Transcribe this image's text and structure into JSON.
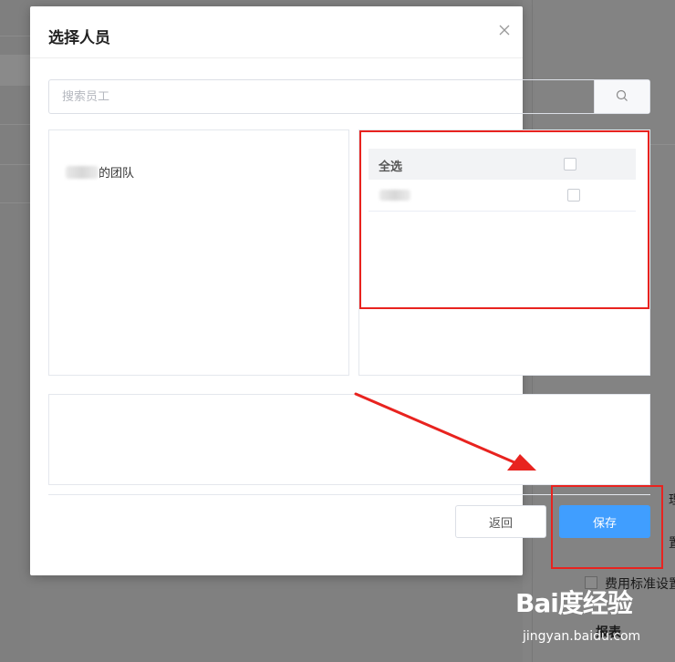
{
  "dialog": {
    "title": "选择人员",
    "close_icon": "close-icon"
  },
  "search": {
    "placeholder": "搜索员工",
    "value": "",
    "icon": "search-icon"
  },
  "left_panel": {
    "team_suffix": "的团队"
  },
  "right_panel": {
    "select_all_label": "全选",
    "select_all_checked": false,
    "rows": [
      {
        "name_blurred": true,
        "checked": false
      }
    ]
  },
  "footer": {
    "back_label": "返回",
    "save_label": "保存"
  },
  "background": {
    "visible_texts": [
      "费用标准设置",
      "报表"
    ]
  },
  "annotation": {
    "color": "#e8231f"
  },
  "watermark": {
    "logo": "Bai度经验",
    "url": "jingyan.baidu.com"
  },
  "colors": {
    "primary": "#409eff",
    "overlay": "#808080"
  }
}
